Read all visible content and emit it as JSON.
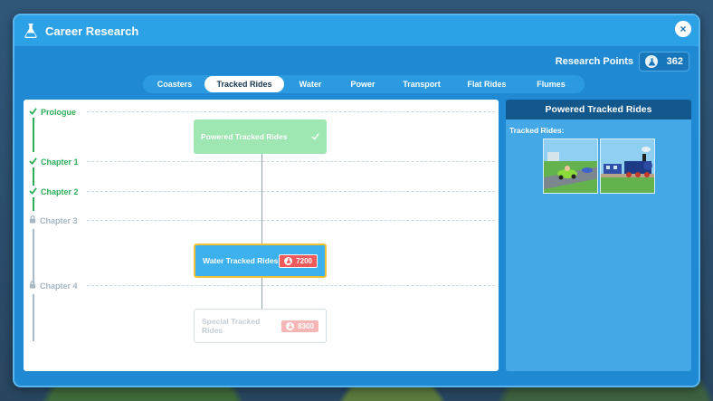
{
  "window": {
    "title": "Career Research",
    "close_label": "×"
  },
  "research_points": {
    "label": "Research Points",
    "value": "362"
  },
  "tabs": [
    {
      "label": "Coasters",
      "active": false
    },
    {
      "label": "Tracked Rides",
      "active": true
    },
    {
      "label": "Water",
      "active": false
    },
    {
      "label": "Power",
      "active": false
    },
    {
      "label": "Transport",
      "active": false
    },
    {
      "label": "Flat Rides",
      "active": false
    },
    {
      "label": "Flumes",
      "active": false
    }
  ],
  "chapters": [
    {
      "label": "Prologue",
      "state": "done"
    },
    {
      "label": "Chapter 1",
      "state": "done"
    },
    {
      "label": "Chapter 2",
      "state": "done"
    },
    {
      "label": "Chapter 3",
      "state": "locked"
    },
    {
      "label": "Chapter 4",
      "state": "locked"
    }
  ],
  "nodes": [
    {
      "label": "Powered Tracked Rides",
      "state": "researched",
      "status_icon": "check-icon"
    },
    {
      "label": "Water Tracked Rides",
      "state": "available",
      "cost": "7200"
    },
    {
      "label": "Special Tracked Rides",
      "state": "locked",
      "cost": "8300"
    }
  ],
  "detail": {
    "title": "Powered Tracked Rides",
    "subtitle": "Tracked Rides:",
    "images": [
      "go-kart-ride-thumbnail",
      "steam-train-ride-thumbnail"
    ]
  },
  "colors": {
    "window_bg": "#1f8ad3",
    "done_green": "#2fae5a",
    "active_node": "#3db0ee",
    "highlight_border": "#f2c23a",
    "cost_red": "#f05a5a",
    "header_dark": "#12588c"
  }
}
